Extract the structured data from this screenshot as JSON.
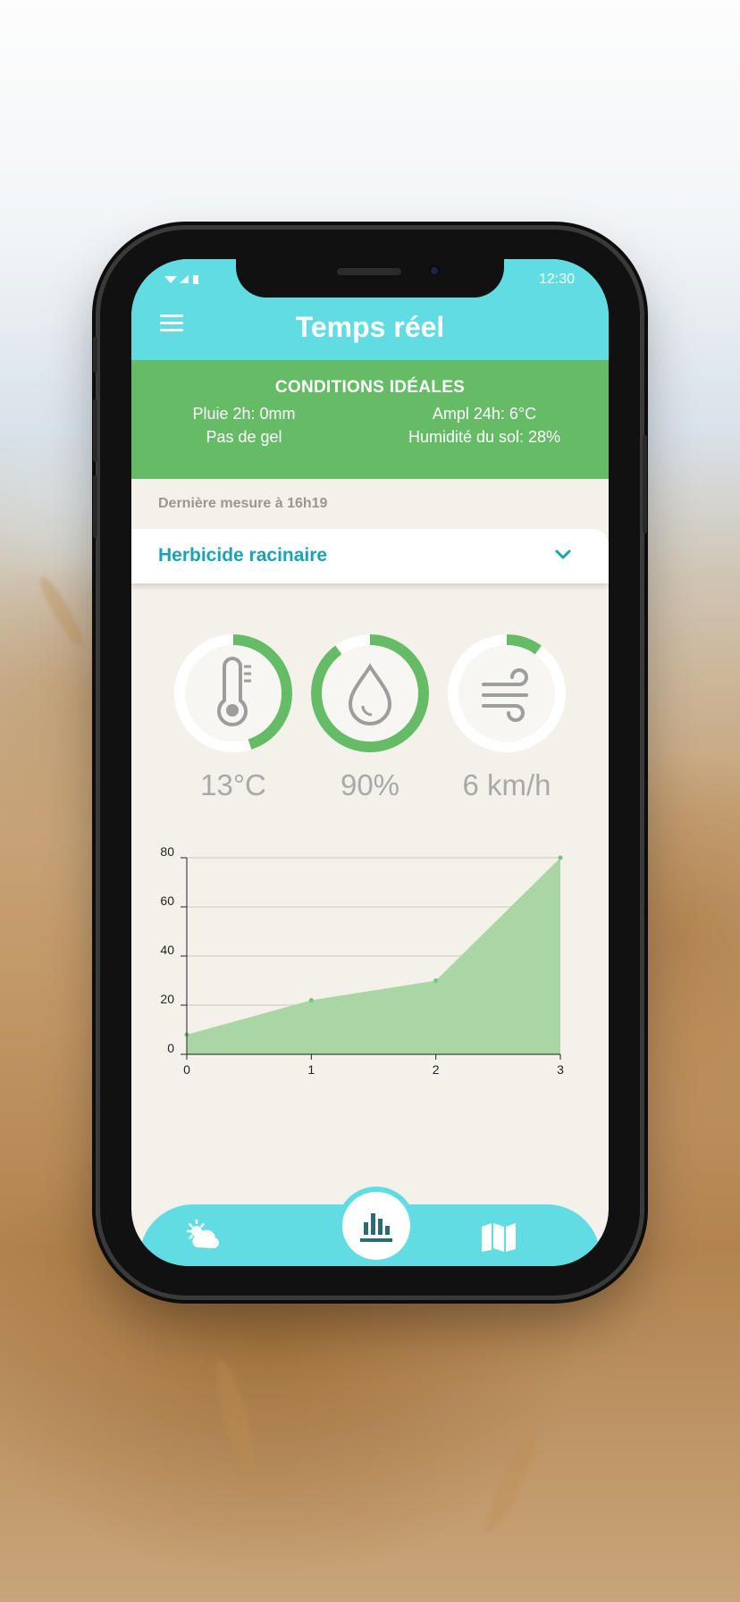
{
  "colors": {
    "appbar": "#62dce3",
    "banner": "#66bb66",
    "accent_text": "#1aa3b8",
    "gauge_track": "#ffffff",
    "gauge_fill": "#66bb66",
    "chart_fill": "#a9d6a4",
    "background_app": "#f4f1ea"
  },
  "status_bar": {
    "time": "12:30",
    "icons": [
      "signal-icon",
      "wifi-icon",
      "battery-icon"
    ]
  },
  "header": {
    "title": "Temps réel",
    "menu_icon": "hamburger-menu-icon"
  },
  "conditions": {
    "title": "CONDITIONS IDÉALES",
    "rain": "Pluie 2h: 0mm",
    "amplitude": "Ampl 24h: 6°C",
    "frost": "Pas de gel",
    "soil_humidity": "Humidité du sol: 28%"
  },
  "last_measure": "Dernière mesure à 16h19",
  "treatment_select": {
    "selected": "Herbicide racinaire",
    "icon": "chevron-down-icon"
  },
  "gauges": [
    {
      "icon": "thermometer-icon",
      "value": "13°C",
      "fill": 0.45
    },
    {
      "icon": "water-drop-icon",
      "value": "90%",
      "fill": 0.9
    },
    {
      "icon": "wind-icon",
      "value": "6 km/h",
      "fill": 0.1
    }
  ],
  "chart_data": {
    "type": "area",
    "x": [
      0,
      1,
      2,
      3
    ],
    "series": [
      {
        "values": [
          8,
          22,
          30,
          80
        ]
      }
    ],
    "xlim": [
      0,
      3
    ],
    "ylim": [
      0,
      80
    ],
    "yticks": [
      0,
      20,
      40,
      60,
      80
    ],
    "xticks": [
      0,
      1,
      2,
      3
    ],
    "grid": true,
    "title": "",
    "xlabel": "",
    "ylabel": ""
  },
  "bottom_nav": {
    "items": [
      {
        "icon": "weather-icon",
        "active": false
      },
      {
        "icon": "bar-chart-icon",
        "active": true
      },
      {
        "icon": "map-icon",
        "active": false
      }
    ]
  }
}
